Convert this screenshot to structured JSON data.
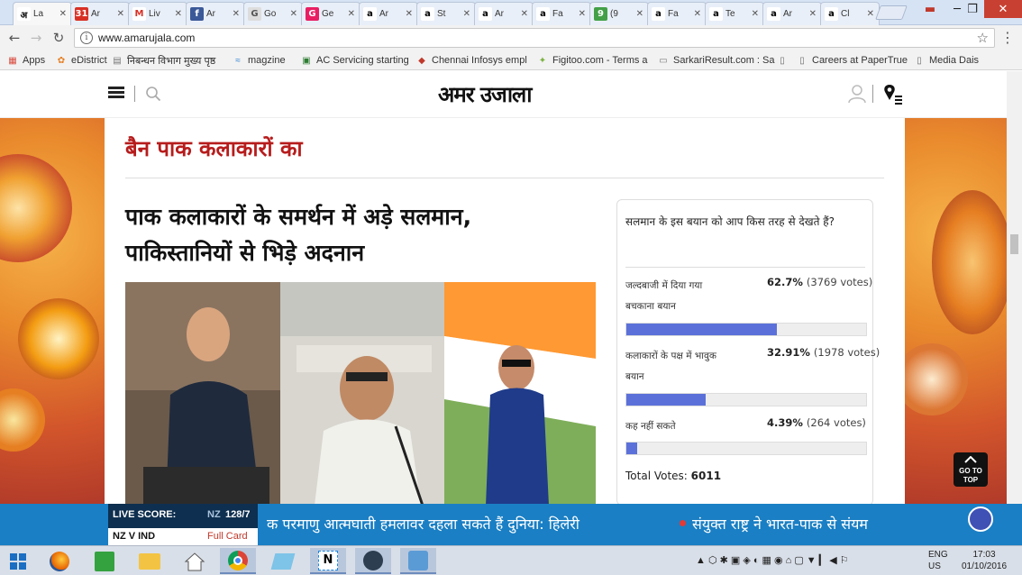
{
  "browser": {
    "tabs": [
      {
        "label": "La",
        "fav_text": "अ",
        "fav_color": "#ffffff",
        "fav_text_color": "#000000"
      },
      {
        "label": "Ar",
        "fav_text": "31",
        "fav_color": "#d93025",
        "fav_text_color": "#ffffff"
      },
      {
        "label": "Liv",
        "fav_text": "M",
        "fav_color": "#ffffff",
        "fav_text_color": "#d93025"
      },
      {
        "label": "Ar",
        "fav_text": "f",
        "fav_color": "#3b5998",
        "fav_text_color": "#ffffff"
      },
      {
        "label": "Go",
        "fav_text": "G",
        "fav_color": "#dddddd",
        "fav_text_color": "#555555"
      },
      {
        "label": "Ge",
        "fav_text": "G",
        "fav_color": "#e91e63",
        "fav_text_color": "#ffffff"
      },
      {
        "label": "Ar",
        "fav_text": "a",
        "fav_color": "#ffffff",
        "fav_text_color": "#000000"
      },
      {
        "label": "St",
        "fav_text": "a",
        "fav_color": "#ffffff",
        "fav_text_color": "#000000"
      },
      {
        "label": "Ar",
        "fav_text": "a",
        "fav_color": "#ffffff",
        "fav_text_color": "#000000"
      },
      {
        "label": "Fa",
        "fav_text": "a",
        "fav_color": "#ffffff",
        "fav_text_color": "#000000"
      },
      {
        "label": "(9",
        "fav_text": "9",
        "fav_color": "#43a047",
        "fav_text_color": "#ffffff"
      },
      {
        "label": "Fa",
        "fav_text": "a",
        "fav_color": "#ffffff",
        "fav_text_color": "#000000"
      },
      {
        "label": "Te",
        "fav_text": "a",
        "fav_color": "#ffffff",
        "fav_text_color": "#000000"
      },
      {
        "label": "Ar",
        "fav_text": "a",
        "fav_color": "#ffffff",
        "fav_text_color": "#000000"
      },
      {
        "label": "Cl",
        "fav_text": "a",
        "fav_color": "#ffffff",
        "fav_text_color": "#000000"
      }
    ],
    "url": "www.amarujala.com",
    "bookmarks": [
      {
        "label": "Apps",
        "icon": "apps-icon"
      },
      {
        "label": "eDistrict",
        "icon": "edistrict-icon"
      },
      {
        "label": "निबन्धन विभाग मुख्य पृष्ठ",
        "icon": "document-icon"
      },
      {
        "label": "magzine",
        "icon": "magzine-icon"
      },
      {
        "label": "AC Servicing starting",
        "icon": "ac-icon"
      },
      {
        "label": "Chennai Infosys empl",
        "icon": "infosys-icon"
      },
      {
        "label": "Figitoo.com - Terms a",
        "icon": "figitoo-icon"
      },
      {
        "label": "SarkariResult.com : Sa",
        "icon": "sarkari-icon"
      },
      {
        "label": "",
        "icon": "page-icon"
      },
      {
        "label": "Careers at PaperTrue",
        "icon": "page-icon"
      },
      {
        "label": "Media Dais",
        "icon": "page-icon"
      }
    ]
  },
  "site": {
    "logo": "अमर उजाला",
    "section_title": "बैन पाक कलाकारों का",
    "headline": "पाक कलाकारों के समर्थन में अड़े सलमान, पाकिस्तानियों से भिड़े अदनान",
    "poll": {
      "question": "सलमान के इस बयान को आप किस तरह से देखते हैं?",
      "options": [
        {
          "label": "जल्दबाजी में दिया गया बचकाना बयान",
          "percent": "62.7%",
          "votes": "(3769 votes)",
          "value": 62.7
        },
        {
          "label": "कलाकारों के पक्ष में भावुक बयान",
          "percent": "32.91%",
          "votes": "(1978 votes)",
          "value": 32.91
        },
        {
          "label": "कह नहीं सकते",
          "percent": "4.39%",
          "votes": "(264 votes)",
          "value": 4.39
        }
      ],
      "total_label": "Total Votes:",
      "total_value": "6011"
    },
    "go_to_top": "GO TO TOP"
  },
  "ticker": {
    "live_score_label": "LIVE SCORE:",
    "team_score_team": "NZ",
    "team_score": "128/7",
    "match": "NZ V IND",
    "full_card": "Full Card",
    "headline_1": "क परमाणु आत्मघाती हमलावर दहला सकते हैं दुनिया: हिलेरी",
    "headline_2": "संयुक्त राष्ट्र ने भारत-पाक से संयम"
  },
  "taskbar": {
    "lang_1": "ENG",
    "lang_2": "US",
    "time": "17:03",
    "date": "01/10/2016"
  },
  "colors": {
    "brand_red": "#b71c1c",
    "poll_bar": "#5b71d9",
    "ticker_blue": "#1a7fc4",
    "ticker_dark": "#0e2f4f"
  }
}
